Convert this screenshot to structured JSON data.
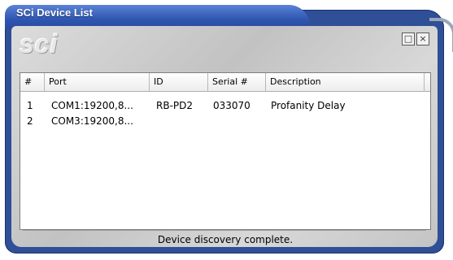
{
  "window": {
    "title": "SCi Device List",
    "logo_text": "sci",
    "buttons": {
      "restore_glyph": "□",
      "close_glyph": "×"
    }
  },
  "table": {
    "columns": [
      "#",
      "Port",
      "ID",
      "Serial #",
      "Description"
    ],
    "rows": [
      {
        "num": "1",
        "port": "COM1:19200,8...",
        "id": "RB-PD2",
        "serial": "033070",
        "description": "Profanity Delay"
      },
      {
        "num": "2",
        "port": "COM3:19200,8...",
        "id": "",
        "serial": "",
        "description": ""
      }
    ]
  },
  "status": {
    "text": "Device discovery complete."
  },
  "colors": {
    "frame": "#2f4f96",
    "title_text": "#ffffff",
    "panel": "#c8c8c8"
  }
}
